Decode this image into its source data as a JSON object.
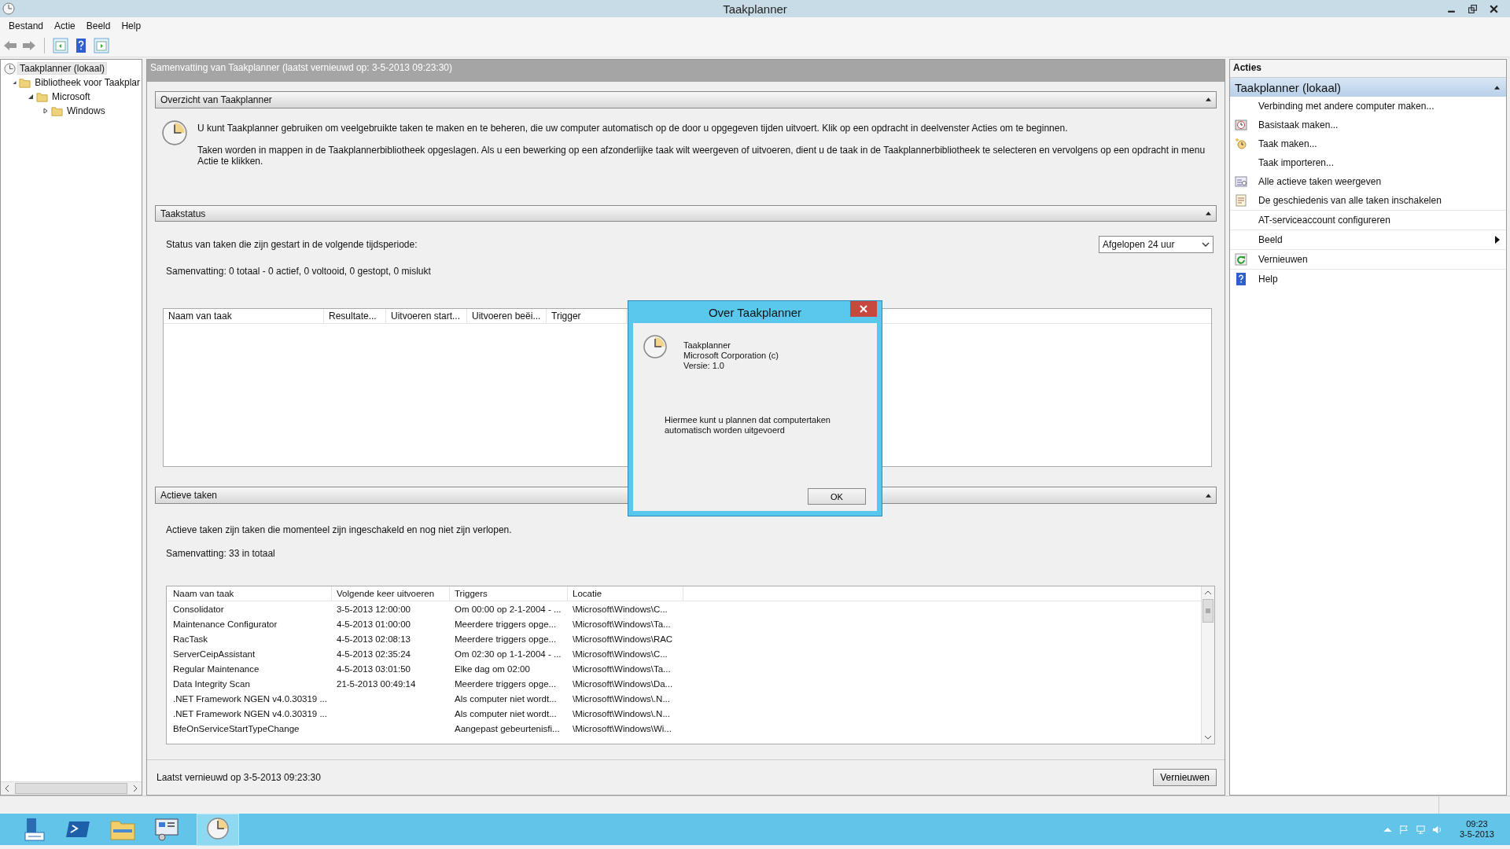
{
  "window": {
    "title": "Taakplanner"
  },
  "menu": [
    "Bestand",
    "Actie",
    "Beeld",
    "Help"
  ],
  "tree": [
    {
      "label": "Taakplanner (lokaal)",
      "selected": true,
      "children": [
        {
          "label": "Bibliotheek voor Taakplar",
          "selected": false,
          "expanded": true,
          "children": [
            {
              "label": "Microsoft",
              "selected": false,
              "expanded": true,
              "children": [
                {
                  "label": "Windows",
                  "selected": false,
                  "expanded": false
                }
              ]
            }
          ]
        }
      ]
    }
  ],
  "summary_bar": "Samenvatting van Taakplanner (laatst vernieuwd op: 3-5-2013 09:23:30)",
  "overview": {
    "title": "Overzicht van Taakplanner",
    "paragraphs": [
      "U kunt Taakplanner gebruiken om veelgebruikte taken te maken en te beheren, die uw computer automatisch op de door u opgegeven tijden uitvoert. Klik op een opdracht in deelvenster Acties om te beginnen.",
      "Taken worden in mappen in de Taakplannerbibliotheek opgeslagen. Als u een bewerking op een afzonderlijke taak wilt weergeven of uitvoeren, dient u de taak in de Taakplannerbibliotheek te selecteren en vervolgens op een opdracht in menu Actie te klikken."
    ]
  },
  "status": {
    "title": "Taakstatus",
    "period_label": "Status van taken die zijn gestart in de volgende tijdsperiode:",
    "period": "Afgelopen 24 uur",
    "summary": "Samenvatting: 0 totaal - 0 actief, 0 voltooid, 0 gestopt, 0 mislukt",
    "columns": [
      "Naam van taak",
      "Resultate...",
      "Uitvoeren start...",
      "Uitvoeren beëi...",
      "Trigger"
    ]
  },
  "active": {
    "title": "Actieve taken",
    "description": "Actieve taken zijn taken die momenteel zijn ingeschakeld en nog niet zijn verlopen.",
    "summary": "Samenvatting: 33 in totaal",
    "columns": [
      "Naam van taak",
      "Volgende keer uitvoeren",
      "Triggers",
      "Locatie"
    ],
    "rows": [
      [
        "Consolidator",
        "3-5-2013 12:00:00",
        "Om 00:00 op 2-1-2004 - ...",
        "\\Microsoft\\Windows\\C..."
      ],
      [
        "Maintenance Configurator",
        "4-5-2013 01:00:00",
        "Meerdere triggers opge...",
        "\\Microsoft\\Windows\\Ta..."
      ],
      [
        "RacTask",
        "4-5-2013 02:08:13",
        "Meerdere triggers opge...",
        "\\Microsoft\\Windows\\RAC"
      ],
      [
        "ServerCeipAssistant",
        "4-5-2013 02:35:24",
        "Om 02:30 op 1-1-2004 - ...",
        "\\Microsoft\\Windows\\C..."
      ],
      [
        "Regular Maintenance",
        "4-5-2013 03:01:50",
        "Elke dag om 02:00",
        "\\Microsoft\\Windows\\Ta..."
      ],
      [
        "Data Integrity Scan",
        "21-5-2013 00:49:14",
        "Meerdere triggers opge...",
        "\\Microsoft\\Windows\\Da..."
      ],
      [
        ".NET Framework NGEN v4.0.30319 ...",
        "",
        "Als computer niet wordt...",
        "\\Microsoft\\Windows\\.N..."
      ],
      [
        ".NET Framework NGEN v4.0.30319 ...",
        "",
        "Als computer niet wordt...",
        "\\Microsoft\\Windows\\.N..."
      ],
      [
        "BfeOnServiceStartTypeChange",
        "",
        "Aangepast gebeurtenisfi...",
        "\\Microsoft\\Windows\\Wi..."
      ]
    ]
  },
  "footer": {
    "text": "Laatst vernieuwd op 3-5-2013 09:23:30",
    "button": "Vernieuwen"
  },
  "actions": {
    "title": "Acties",
    "group": "Taakplanner (lokaal)",
    "items": [
      {
        "label": "Verbinding met andere computer maken...",
        "submenu": false
      },
      {
        "label": "Basistaak maken...",
        "submenu": false
      },
      {
        "label": "Taak maken...",
        "submenu": false
      },
      {
        "label": "Taak importeren...",
        "submenu": false
      },
      {
        "label": "Alle actieve taken weergeven",
        "submenu": false
      },
      {
        "label": "De geschiedenis van alle taken inschakelen",
        "submenu": false
      },
      {
        "label": "AT-serviceaccount configureren",
        "submenu": false
      },
      {
        "label": "Beeld",
        "submenu": true
      },
      {
        "label": "Vernieuwen",
        "submenu": false
      },
      {
        "label": "Help",
        "submenu": false
      }
    ]
  },
  "dialog": {
    "title": "Over Taakplanner",
    "lines": [
      "Taakplanner",
      "Microsoft Corporation (c)",
      "Versie: 1.0"
    ],
    "description": "Hiermee kunt u plannen dat computertaken automatisch worden uitgevoerd",
    "button": "OK"
  },
  "taskbar": {
    "time": "09:23",
    "date": "3-5-2013"
  }
}
